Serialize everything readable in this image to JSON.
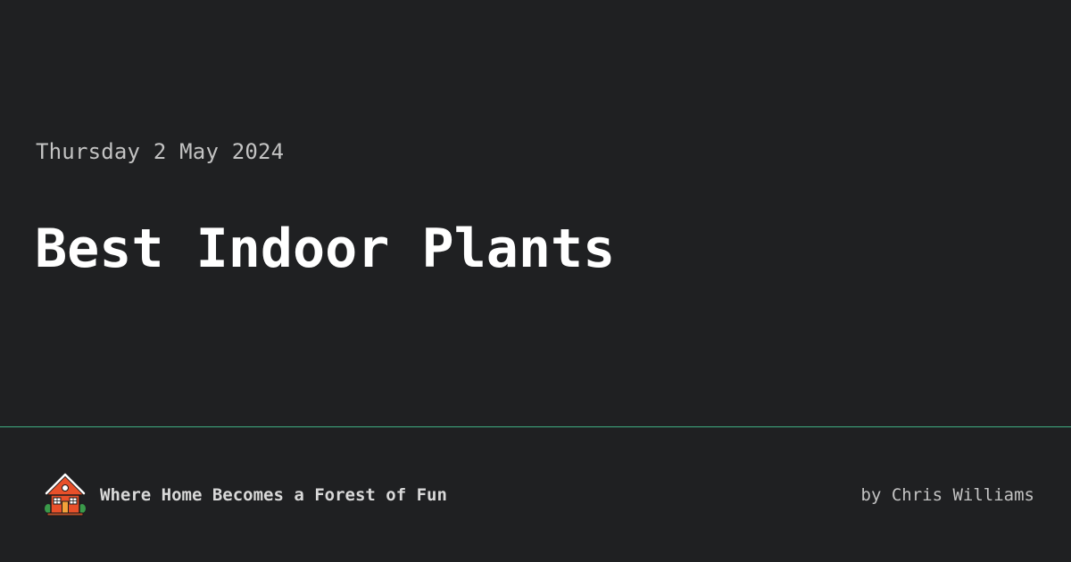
{
  "post": {
    "date": "Thursday 2 May 2024",
    "title": "Best Indoor Plants"
  },
  "footer": {
    "logo_icon": "house-icon",
    "tagline": "Where Home Becomes a Forest of Fun",
    "byline": "by Chris Williams"
  },
  "colors": {
    "background": "#1f2022",
    "divider": "#3fae82",
    "title": "#ffffff",
    "muted_text": "#c3c3c3"
  }
}
